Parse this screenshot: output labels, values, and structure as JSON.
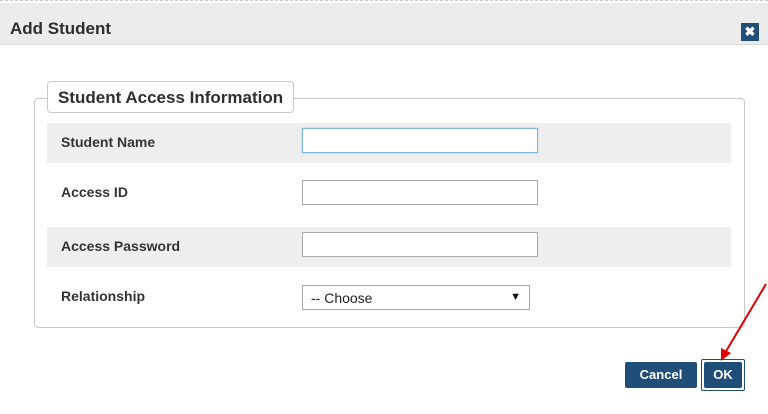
{
  "dialog": {
    "title": "Add Student",
    "close_icon": "close-icon"
  },
  "section": {
    "legend": "Student Access Information"
  },
  "fields": [
    {
      "label": "Student Name",
      "value": "",
      "focused": true
    },
    {
      "label": "Access ID",
      "value": ""
    },
    {
      "label": "Access Password",
      "value": ""
    },
    {
      "label": "Relationship",
      "selected": "-- Choose",
      "icon": "caret-down-icon"
    }
  ],
  "buttons": {
    "cancel": "Cancel",
    "ok": "OK"
  },
  "colors": {
    "button_bg": "#1f4e79",
    "titlebar_bg": "#ececec",
    "row_shade": "#eeeeee",
    "annotation_arrow": "#e00000"
  }
}
